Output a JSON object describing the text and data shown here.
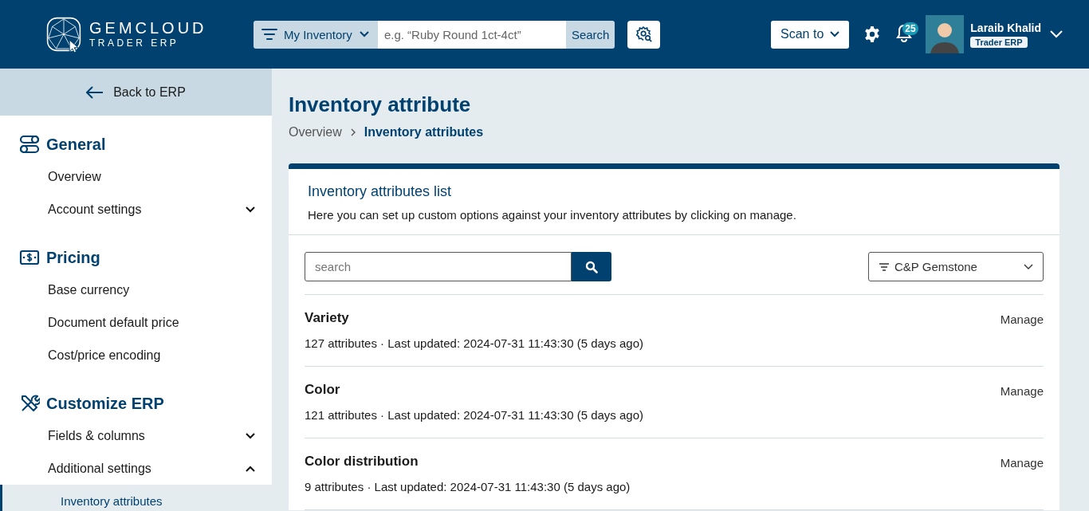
{
  "header": {
    "logo": {
      "name": "GEMCLOUD",
      "subtitle": "TRADER ERP"
    },
    "search": {
      "scope": "My Inventory",
      "placeholder": "e.g. “Ruby Round 1ct-4ct”",
      "button": "Search"
    },
    "scan_button": "Scan to",
    "notifications": {
      "count": "25"
    },
    "user": {
      "name": "Laraib Khalid",
      "role": "Trader ERP"
    }
  },
  "sidebar": {
    "back": "Back to ERP",
    "sections": [
      {
        "title": "General",
        "items": [
          {
            "label": "Overview",
            "kind": "link",
            "selected": false
          },
          {
            "label": "Account settings",
            "kind": "group",
            "expanded": false,
            "selected": false
          }
        ]
      },
      {
        "title": "Pricing",
        "items": [
          {
            "label": "Base currency",
            "kind": "link",
            "selected": false
          },
          {
            "label": "Document default price",
            "kind": "link",
            "selected": false
          },
          {
            "label": "Cost/price encoding",
            "kind": "link",
            "selected": false
          }
        ]
      },
      {
        "title": "Customize ERP",
        "items": [
          {
            "label": "Fields & columns",
            "kind": "group",
            "expanded": false,
            "selected": false
          },
          {
            "label": "Additional settings",
            "kind": "group",
            "expanded": true,
            "selected": false,
            "children": [
              {
                "label": "Inventory attributes",
                "selected": true
              }
            ]
          }
        ]
      }
    ]
  },
  "page": {
    "title": "Inventory attribute",
    "breadcrumb": [
      {
        "label": "Overview",
        "current": false
      },
      {
        "label": "Inventory attributes",
        "current": true
      }
    ],
    "card": {
      "title": "Inventory attributes list",
      "description": "Here you can set up custom options against your inventory attributes by clicking on manage.",
      "search_placeholder": "search",
      "filter": "C&P Gemstone",
      "rows": [
        {
          "name": "Variety",
          "meta": "127 attributes · Last updated: 2024-07-31 11:43:30 (5 days ago)",
          "action": "Manage"
        },
        {
          "name": "Color",
          "meta": "121 attributes · Last updated: 2024-07-31 11:43:30 (5 days ago)",
          "action": "Manage"
        },
        {
          "name": "Color distribution",
          "meta": "9 attributes · Last updated: 2024-07-31 11:43:30 (5 days ago)",
          "action": "Manage"
        }
      ]
    }
  }
}
